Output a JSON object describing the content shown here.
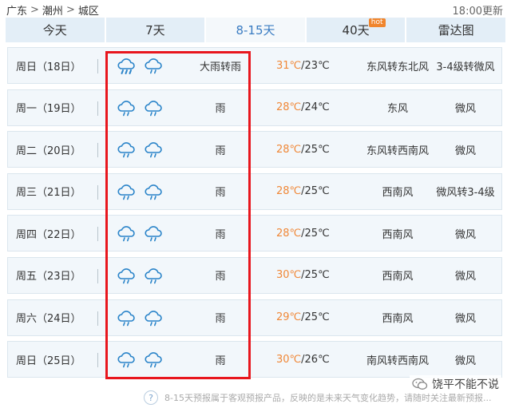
{
  "breadcrumb": {
    "province": "广东",
    "city": "潮州",
    "district": "城区"
  },
  "update_time": "18:00更新",
  "tabs": [
    {
      "label": "今天"
    },
    {
      "label": "7天"
    },
    {
      "label": "8-15天",
      "active": true
    },
    {
      "label": "40天",
      "badge": "hot"
    },
    {
      "label": "雷达图"
    }
  ],
  "forecast": [
    {
      "day": "周日（18日）",
      "weather": "大雨转雨",
      "icon_day": "heavy-rain-icon",
      "icon_night": "rain-icon",
      "high": "31℃",
      "low": "/23℃",
      "wind": "东风转东北风",
      "level": "3-4级转微风"
    },
    {
      "day": "周一（19日）",
      "weather": "雨",
      "icon_day": "rain-icon",
      "icon_night": "rain-icon",
      "high": "28℃",
      "low": "/24℃",
      "wind": "东风",
      "level": "微风"
    },
    {
      "day": "周二（20日）",
      "weather": "雨",
      "icon_day": "rain-icon",
      "icon_night": "rain-icon",
      "high": "28℃",
      "low": "/25℃",
      "wind": "东风转西南风",
      "level": "微风"
    },
    {
      "day": "周三（21日）",
      "weather": "雨",
      "icon_day": "rain-icon",
      "icon_night": "rain-icon",
      "high": "28℃",
      "low": "/25℃",
      "wind": "西南风",
      "level": "微风转3-4级"
    },
    {
      "day": "周四（22日）",
      "weather": "雨",
      "icon_day": "rain-icon",
      "icon_night": "rain-icon",
      "high": "28℃",
      "low": "/25℃",
      "wind": "西南风",
      "level": "微风"
    },
    {
      "day": "周五（23日）",
      "weather": "雨",
      "icon_day": "rain-icon",
      "icon_night": "rain-icon",
      "high": "30℃",
      "low": "/25℃",
      "wind": "西南风",
      "level": "微风"
    },
    {
      "day": "周六（24日）",
      "weather": "雨",
      "icon_day": "rain-icon",
      "icon_night": "rain-icon",
      "high": "29℃",
      "low": "/25℃",
      "wind": "西南风",
      "level": "微风"
    },
    {
      "day": "周日（25日）",
      "weather": "雨",
      "icon_day": "rain-icon",
      "icon_night": "rain-icon",
      "high": "30℃",
      "low": "/26℃",
      "wind": "南风转西南风",
      "level": "微风"
    }
  ],
  "footnote": "8-15天预报属于客观预报产品，反映的是未来天气变化趋势，请随时关注最新预报...",
  "help_icon": "?",
  "watermark": "饶平不能不说",
  "colors": {
    "accent": "#3a7cc2",
    "high_temp": "#f08838",
    "highlight_border": "#e8161d",
    "tab_bg": "#e3eef7",
    "row_bg": "#f2f7fb"
  }
}
